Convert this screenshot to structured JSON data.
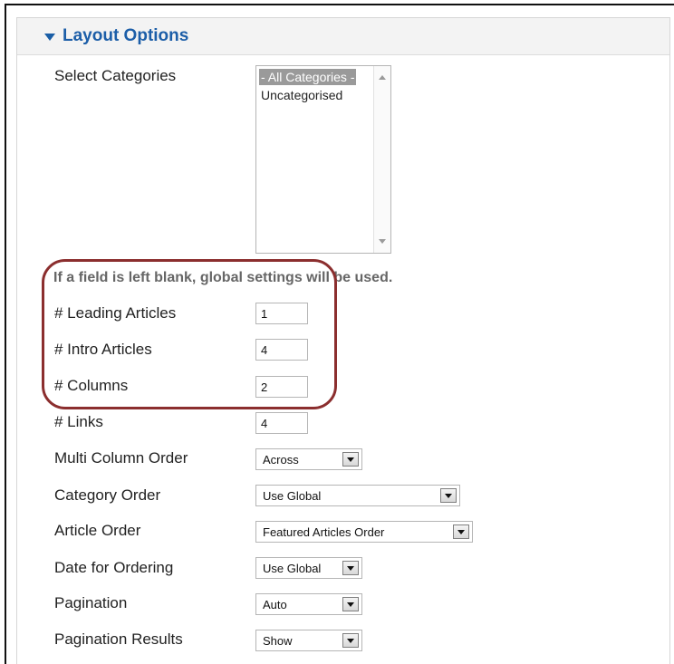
{
  "panel": {
    "title": "Layout Options"
  },
  "categories": {
    "label": "Select Categories",
    "options": [
      "- All Categories -",
      "Uncategorised"
    ]
  },
  "note": "If a field is left blank, global settings will be used.",
  "fields": {
    "leading_articles": {
      "label": "# Leading Articles",
      "value": "1"
    },
    "intro_articles": {
      "label": "# Intro Articles",
      "value": "4"
    },
    "columns": {
      "label": "# Columns",
      "value": "2"
    },
    "links": {
      "label": "# Links",
      "value": "4"
    }
  },
  "selects": {
    "multi_column_order": {
      "label": "Multi Column Order",
      "value": "Across"
    },
    "category_order": {
      "label": "Category Order",
      "value": "Use Global"
    },
    "article_order": {
      "label": "Article Order",
      "value": "Featured Articles Order"
    },
    "date_for_ordering": {
      "label": "Date for Ordering",
      "value": "Use Global"
    },
    "pagination": {
      "label": "Pagination",
      "value": "Auto"
    },
    "pagination_results": {
      "label": "Pagination Results",
      "value": "Show"
    }
  },
  "colors": {
    "header_text": "#1c5ea8",
    "highlight": "#8b2e2e",
    "selected_option_bg": "#9a9a9a"
  }
}
